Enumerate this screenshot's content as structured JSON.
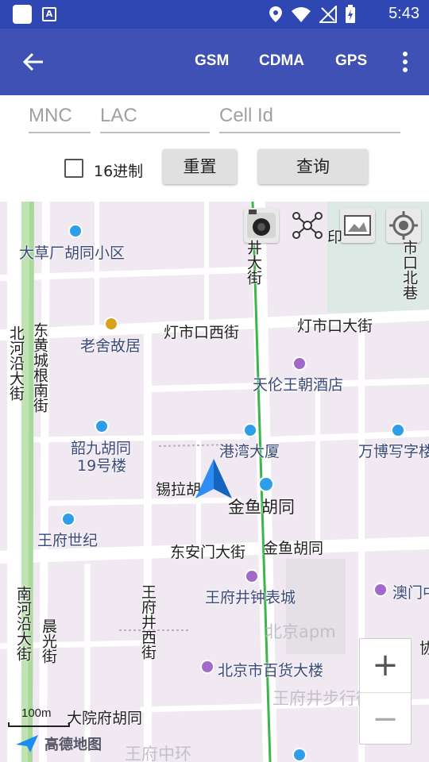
{
  "status_bar": {
    "time": "5:43"
  },
  "app_bar": {
    "tabs": [
      "GSM",
      "CDMA",
      "GPS"
    ]
  },
  "form": {
    "mnc_placeholder": "MNC",
    "lac_placeholder": "LAC",
    "cellid_placeholder": "Cell Id",
    "hex_label": "16进制",
    "hex_checked": false,
    "reset_label": "重置",
    "query_label": "查询"
  },
  "map": {
    "labels": {
      "dacaochang": "大草厂胡同小区",
      "laoshe": "老舍故居",
      "dengshikou_w": "灯市口西街",
      "dengshikou_d": "灯市口大街",
      "jingyu_hotel": "天伦王朝酒店",
      "shaojiu": "韶九胡同",
      "building19": "19号楼",
      "hkmacau": "港湾大厦",
      "wanbo": "万博写字楼",
      "xila": "锡拉胡",
      "jinyu_big": "金鱼胡同",
      "wangfu_shiji": "王府世纪",
      "donganmen": "东安门大街",
      "jinyu_road": "金鱼胡同",
      "wangfujing_clock": "王府井钟表城",
      "aomen": "澳门中",
      "beijing_apm": "北京apm",
      "bjdept": "北京市百货大楼",
      "pedestrian": "王府井步行街",
      "dayuanfu": "大院府胡同",
      "wangfu_zhonghuan": "王府中环",
      "beiheyan": "北河沿大街",
      "donghuangcheng": "东黄城根南街",
      "jingdajie": "井大街",
      "shikou": "市口北巷",
      "nanheyan": "南河沿大街",
      "chenguang": "晨光街",
      "wangfujingxi": "王府井西街",
      "cut_right": "协",
      "cut_top": "印"
    },
    "scale_label": "100m",
    "logo_text": "高德地图",
    "zoom_in": "+",
    "zoom_out": "−"
  }
}
